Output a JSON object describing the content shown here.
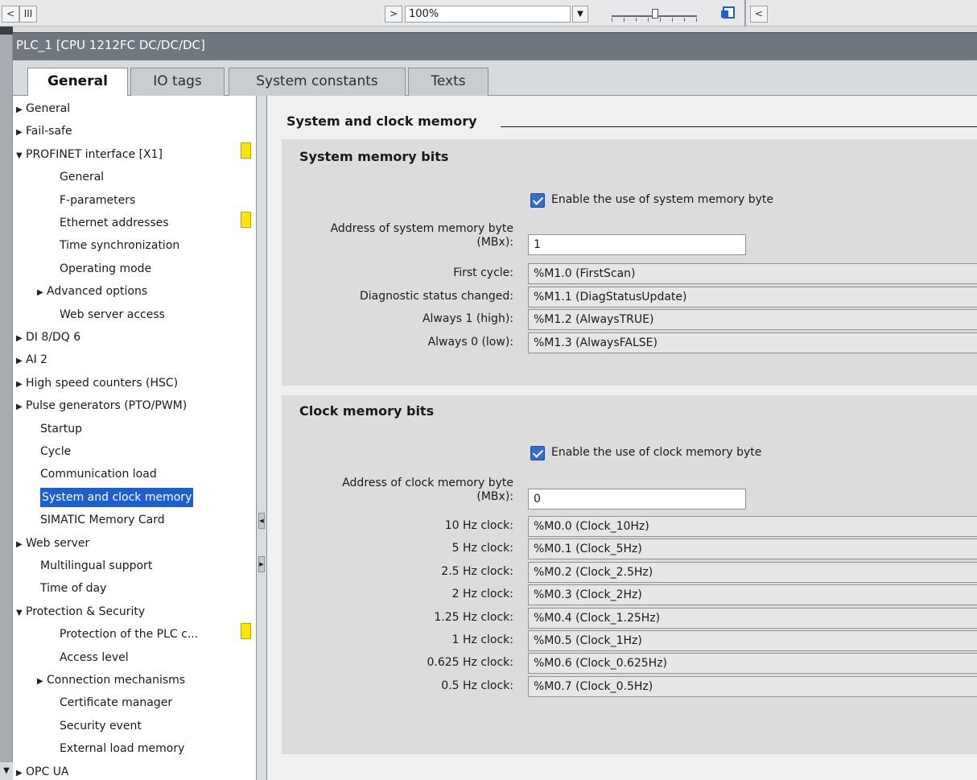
{
  "toolbar": {
    "left_scroll": "<",
    "scroll_grip": "III",
    "right_scroll": ">",
    "zoom_value": "100%",
    "zoom_dropdown": "▼",
    "far_left": "<"
  },
  "window_title": "PLC_1 [CPU 1212FC DC/DC/DC]",
  "tabs": [
    {
      "label": "General",
      "active": true
    },
    {
      "label": "IO tags"
    },
    {
      "label": "System constants"
    },
    {
      "label": "Texts"
    }
  ],
  "tree": [
    {
      "label": "General",
      "arrow": "▶",
      "indent": 0
    },
    {
      "label": "Fail-safe",
      "arrow": "▶",
      "indent": 0,
      "warn": true
    },
    {
      "label": "PROFINET interface [X1]",
      "arrow": "▼",
      "indent": 0
    },
    {
      "label": "General",
      "indent": 2
    },
    {
      "label": "F-parameters",
      "indent": 2,
      "warn": true
    },
    {
      "label": "Ethernet addresses",
      "indent": 2
    },
    {
      "label": "Time synchronization",
      "indent": 2
    },
    {
      "label": "Operating mode",
      "indent": 2
    },
    {
      "label": "Advanced options",
      "arrow": "▶",
      "indent": 1
    },
    {
      "label": "Web server access",
      "indent": 2
    },
    {
      "label": "DI 8/DQ 6",
      "arrow": "▶",
      "indent": 0
    },
    {
      "label": "AI 2",
      "arrow": "▶",
      "indent": 0
    },
    {
      "label": "High speed counters (HSC)",
      "arrow": "▶",
      "indent": 0
    },
    {
      "label": "Pulse generators (PTO/PWM)",
      "arrow": "▶",
      "indent": 0
    },
    {
      "label": "Startup",
      "indent": 1
    },
    {
      "label": "Cycle",
      "indent": 1
    },
    {
      "label": "Communication load",
      "indent": 1
    },
    {
      "label": "System and clock memory",
      "indent": 1,
      "selected": true
    },
    {
      "label": "SIMATIC Memory Card",
      "indent": 1
    },
    {
      "label": "Web server",
      "arrow": "▶",
      "indent": 0
    },
    {
      "label": "Multilingual support",
      "indent": 1
    },
    {
      "label": "Time of day",
      "indent": 1
    },
    {
      "label": "Protection & Security",
      "arrow": "▼",
      "indent": 0,
      "warn": true
    },
    {
      "label": "Protection of the PLC c...",
      "indent": 2
    },
    {
      "label": "Access level",
      "indent": 2
    },
    {
      "label": "Connection mechanisms",
      "arrow": "▶",
      "indent": 1
    },
    {
      "label": "Certificate manager",
      "indent": 2
    },
    {
      "label": "Security event",
      "indent": 2
    },
    {
      "label": "External load memory",
      "indent": 2
    },
    {
      "label": "OPC UA",
      "arrow": "▶",
      "indent": 0
    }
  ],
  "section_title": "System and clock memory",
  "system_memory": {
    "title": "System memory bits",
    "enable_label": "Enable the use of system memory byte",
    "address_label_line1": "Address of system memory byte",
    "address_label_line2": "(MBx):",
    "address_value": "1",
    "rows": [
      {
        "label": "First cycle:",
        "value": "%M1.0 (FirstScan)"
      },
      {
        "label": "Diagnostic status changed:",
        "value": "%M1.1 (DiagStatusUpdate)"
      },
      {
        "label": "Always 1 (high):",
        "value": "%M1.2 (AlwaysTRUE)"
      },
      {
        "label": "Always 0 (low):",
        "value": "%M1.3 (AlwaysFALSE)"
      }
    ]
  },
  "clock_memory": {
    "title": "Clock memory bits",
    "enable_label": "Enable the use of clock memory byte",
    "address_label_line1": "Address of clock memory byte",
    "address_label_line2": "(MBx):",
    "address_value": "0",
    "rows": [
      {
        "label": "10 Hz clock:",
        "value": "%M0.0 (Clock_10Hz)"
      },
      {
        "label": "5 Hz clock:",
        "value": "%M0.1 (Clock_5Hz)"
      },
      {
        "label": "2.5 Hz clock:",
        "value": "%M0.2 (Clock_2.5Hz)"
      },
      {
        "label": "2 Hz clock:",
        "value": "%M0.3 (Clock_2Hz)"
      },
      {
        "label": "1.25 Hz clock:",
        "value": "%M0.4 (Clock_1.25Hz)"
      },
      {
        "label": "1 Hz clock:",
        "value": "%M0.5 (Clock_1Hz)"
      },
      {
        "label": "0.625 Hz clock:",
        "value": "%M0.6 (Clock_0.625Hz)"
      },
      {
        "label": "0.5 Hz clock:",
        "value": "%M0.7 (Clock_0.5Hz)"
      }
    ]
  },
  "colors": {
    "selection": "#1b5fd1",
    "title_bar": "#6f7780",
    "warning": "#ffe500",
    "checkbox": "#2f6fd0"
  }
}
